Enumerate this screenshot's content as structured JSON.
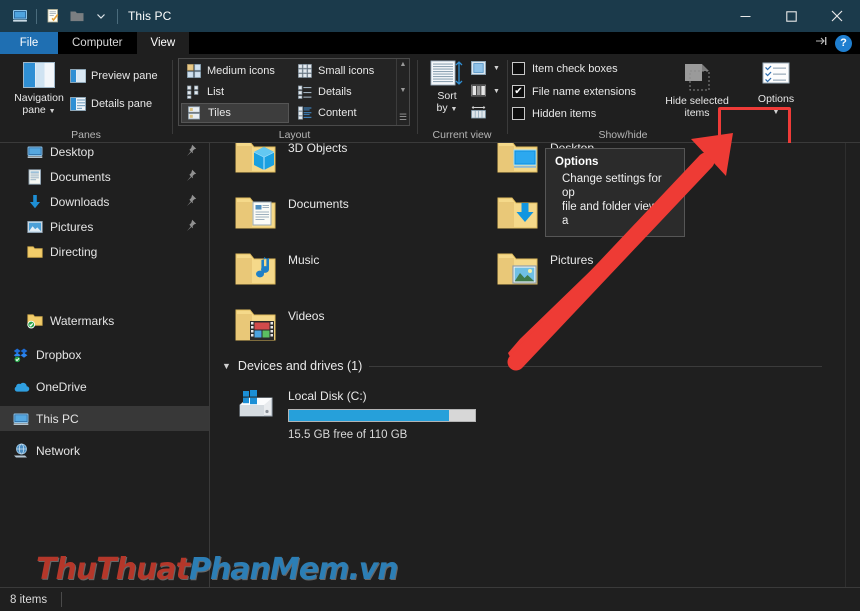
{
  "window": {
    "title": "This PC",
    "quick_access": [
      "this-pc-icon",
      "properties-icon",
      "new-folder-icon",
      "customize-dropdown-icon"
    ],
    "minimize_label": "‒",
    "maximize_label": "□",
    "close_label": "✕",
    "titlebar_color": "#1b3a4b"
  },
  "tabs": {
    "file": "File",
    "items": [
      {
        "label": "Computer",
        "active": false
      },
      {
        "label": "View",
        "active": true
      }
    ],
    "collapse_ribbon_icon": "pin-ribbon-icon",
    "help_label": "?"
  },
  "ribbon": {
    "groups": [
      {
        "label": "Panes"
      },
      {
        "label": "Layout"
      },
      {
        "label": "Current view"
      },
      {
        "label": "Show/hide"
      }
    ],
    "panes": {
      "navigation_pane": "Navigation\npane",
      "navigation_pane_line1": "Navigation",
      "navigation_pane_line2": "pane",
      "preview_pane": "Preview pane",
      "details_pane": "Details pane"
    },
    "layout": {
      "options": [
        {
          "label": "Medium icons",
          "selected": false
        },
        {
          "label": "Small icons",
          "selected": false
        },
        {
          "label": "List",
          "selected": false
        },
        {
          "label": "Details",
          "selected": false
        },
        {
          "label": "Tiles",
          "selected": true
        },
        {
          "label": "Content",
          "selected": false
        }
      ],
      "scroll_up": "▲",
      "scroll_down": "▼",
      "expand": "☰"
    },
    "current_view": {
      "sort_by_line1": "Sort",
      "sort_by_line2": "by",
      "add_columns_icon": "add-columns-icon",
      "size_columns_icon": "size-all-columns-icon",
      "group_by_icon": "group-by-icon"
    },
    "show_hide": {
      "checkboxes": [
        {
          "label": "Item check boxes",
          "checked": false
        },
        {
          "label": "File name extensions",
          "checked": true
        },
        {
          "label": "Hidden items",
          "checked": false
        }
      ],
      "hide_selected_line1": "Hide selected",
      "hide_selected_line2": "items",
      "options_label": "Options",
      "options_highlight_color": "#ee3b38"
    }
  },
  "sidebar": {
    "items": [
      {
        "label": "Desktop",
        "icon": "desktop-icon",
        "pinned": true,
        "selected": false,
        "indent": 1
      },
      {
        "label": "Documents",
        "icon": "documents-icon",
        "pinned": true,
        "selected": false,
        "indent": 1
      },
      {
        "label": "Downloads",
        "icon": "downloads-icon",
        "pinned": true,
        "selected": false,
        "indent": 1
      },
      {
        "label": "Pictures",
        "icon": "pictures-icon",
        "pinned": true,
        "selected": false,
        "indent": 1
      },
      {
        "label": "Directing",
        "icon": "folder-icon",
        "pinned": false,
        "selected": false,
        "indent": 1
      },
      {
        "label": "Watermarks",
        "icon": "folder-sync-icon",
        "pinned": false,
        "selected": false,
        "indent": 1
      },
      {
        "label": "Dropbox",
        "icon": "dropbox-icon",
        "pinned": false,
        "selected": false,
        "indent": 0
      },
      {
        "label": "OneDrive",
        "icon": "onedrive-cloud-icon",
        "pinned": false,
        "selected": false,
        "indent": 0
      },
      {
        "label": "This PC",
        "icon": "this-pc-icon",
        "pinned": false,
        "selected": true,
        "indent": 0
      },
      {
        "label": "Network",
        "icon": "network-icon",
        "pinned": false,
        "selected": false,
        "indent": 0
      }
    ]
  },
  "content": {
    "folders": [
      {
        "label": "3D Objects",
        "icon": "folder-3dobjects-icon"
      },
      {
        "label": "Desktop",
        "icon": "folder-desktop-icon"
      },
      {
        "label": "Documents",
        "icon": "folder-documents-icon"
      },
      {
        "label": "Downloads",
        "icon": "folder-downloads-icon"
      },
      {
        "label": "Music",
        "icon": "folder-music-icon"
      },
      {
        "label": "Pictures",
        "icon": "folder-pictures-icon"
      },
      {
        "label": "Videos",
        "icon": "folder-videos-icon"
      }
    ],
    "devices_group": {
      "header": "Devices and drives (1)",
      "drives": [
        {
          "name": "Local Disk (C:)",
          "free_text": "15.5 GB free of 110 GB",
          "used_percent": 86,
          "bar_color": "#26a0da"
        }
      ]
    }
  },
  "tooltip": {
    "title": "Options",
    "line1": "Change settings for op",
    "line2": "file and folder views, a"
  },
  "statusbar": {
    "item_count": "8 items"
  },
  "watermark": {
    "part1": "ThuThuat",
    "part2": "PhanMem.vn",
    "color1": "#c0392b",
    "color2": "#2e86c1"
  },
  "annotation": {
    "arrow_color": "#ee3b35",
    "arrow_description": "red-arrow-pointing-to-options"
  }
}
